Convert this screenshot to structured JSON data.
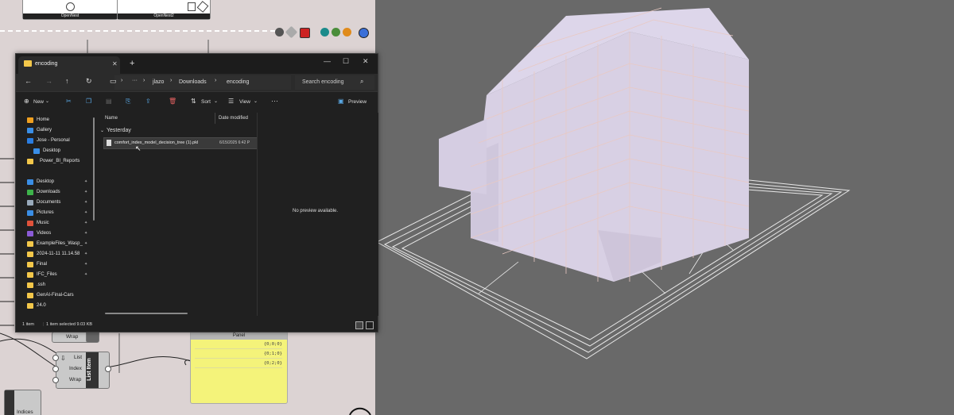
{
  "canvas": {
    "tabs": [
      {
        "label": "OpenNest"
      },
      {
        "label": "OpenNest2"
      }
    ]
  },
  "explorer": {
    "tab_title": "encoding",
    "new_tab_glyph": "+",
    "window_controls": {
      "minimize": "—",
      "maximize": "☐",
      "close": "✕"
    },
    "address": {
      "back": "←",
      "forward": "→",
      "up": "↑",
      "refresh": "↻",
      "monitor": "▭",
      "chevron": "›",
      "more": "···",
      "crumbs": [
        "jlazo",
        "Downloads",
        "encoding"
      ],
      "search_placeholder": "Search encoding"
    },
    "toolbar": {
      "new": "New",
      "sort": "Sort",
      "view": "View",
      "more": "···",
      "preview": "Preview"
    },
    "nav_items": [
      {
        "label": "Home",
        "icon": "home-icon",
        "color": "#f0a020",
        "pinned": false
      },
      {
        "label": "Gallery",
        "icon": "gallery-icon",
        "color": "#3a8ee6",
        "pinned": false
      },
      {
        "label": "Jose - Personal",
        "icon": "onedrive-icon",
        "color": "#2a7de1",
        "pinned": false
      },
      {
        "label": "Desktop",
        "icon": "desktop-icon",
        "color": "#3a8ee6",
        "pinned": false
      },
      {
        "label": "Power_BI_Reports",
        "icon": "folder-icon",
        "color": "#f3c74a",
        "pinned": false
      },
      {
        "label": "Desktop",
        "icon": "desktop-icon",
        "color": "#3a8ee6",
        "pinned": true
      },
      {
        "label": "Downloads",
        "icon": "download-icon",
        "color": "#3db34a",
        "pinned": true
      },
      {
        "label": "Documents",
        "icon": "document-icon",
        "color": "#9ab",
        "pinned": true
      },
      {
        "label": "Pictures",
        "icon": "picture-icon",
        "color": "#3a8ee6",
        "pinned": true
      },
      {
        "label": "Music",
        "icon": "music-icon",
        "color": "#e0523a",
        "pinned": true
      },
      {
        "label": "Videos",
        "icon": "video-icon",
        "color": "#8b5bd6",
        "pinned": true
      },
      {
        "label": "ExampleFiles_Wasp_",
        "icon": "folder-icon",
        "color": "#f3c74a",
        "pinned": true
      },
      {
        "label": "2024-11-11 11.14.58",
        "icon": "folder-icon",
        "color": "#f3c74a",
        "pinned": true
      },
      {
        "label": "Final",
        "icon": "folder-icon",
        "color": "#f3c74a",
        "pinned": true
      },
      {
        "label": "IFC_Files",
        "icon": "folder-icon",
        "color": "#f3c74a",
        "pinned": true
      },
      {
        "label": ".ssh",
        "icon": "folder-icon",
        "color": "#f3c74a",
        "pinned": false
      },
      {
        "label": "GenAI-Final-Cars",
        "icon": "folder-icon",
        "color": "#f3c74a",
        "pinned": false
      },
      {
        "label": "24.0",
        "icon": "folder-icon",
        "color": "#f3c74a",
        "pinned": false
      }
    ],
    "columns": {
      "name": "Name",
      "date": "Date modified"
    },
    "group": "Yesterday",
    "file": {
      "name": "comfort_index_model_decision_tree (1).pkl",
      "date": "6/15/2025 6:42 P"
    },
    "preview_text": "No preview available.",
    "status": {
      "count": "1 item",
      "selected": "1 item selected  9.03 KB"
    }
  },
  "grasshopper": {
    "panel_title": "Panel",
    "panel_rows": [
      "{0;0;0}",
      "{0;1;0}",
      "{0;2;0}"
    ],
    "list_item": {
      "inputs": [
        "List",
        "Index",
        "Wrap"
      ],
      "title": "List Item",
      "prev_label": "Wrap"
    },
    "indices_label": "Indices"
  }
}
